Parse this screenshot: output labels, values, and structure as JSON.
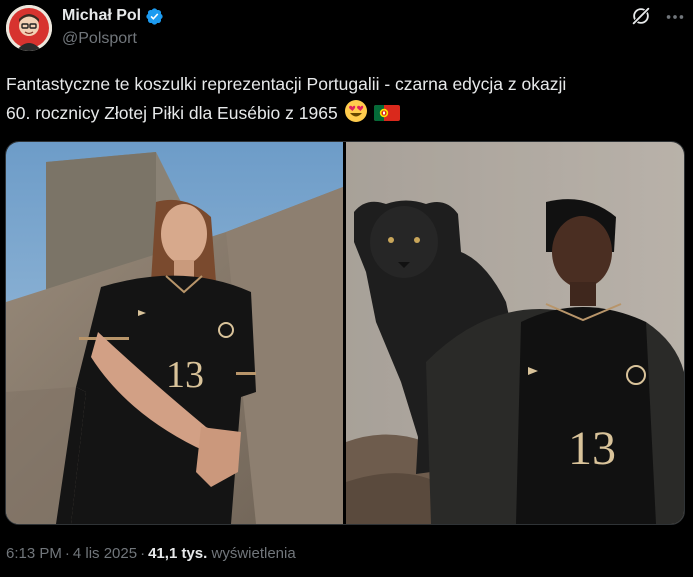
{
  "author": {
    "display_name": "Michał Pol",
    "handle": "@Polsport"
  },
  "tweet": {
    "text_line1": "Fantastyczne te koszulki  reprezentacji Portugalii - czarna edycja z okazji",
    "text_line2": "60. rocznicy Złotej Piłki dla Eusébio z 1965"
  },
  "media": {
    "left_photo_jersey_number": "13",
    "right_photo_jersey_number": "13"
  },
  "meta": {
    "time": "6:13 PM",
    "date": "4 lis 2025",
    "separator": "·",
    "views_count": "41,1 tys.",
    "views_label": "wyświetlenia"
  },
  "colors": {
    "background": "#000000",
    "text_primary": "#e7e9ea",
    "text_secondary": "#71767b",
    "verified_blue": "#1d9bf0"
  },
  "icons": {
    "verified": "verified-badge-icon",
    "grok": "grok-icon",
    "more": "more-options-icon"
  }
}
